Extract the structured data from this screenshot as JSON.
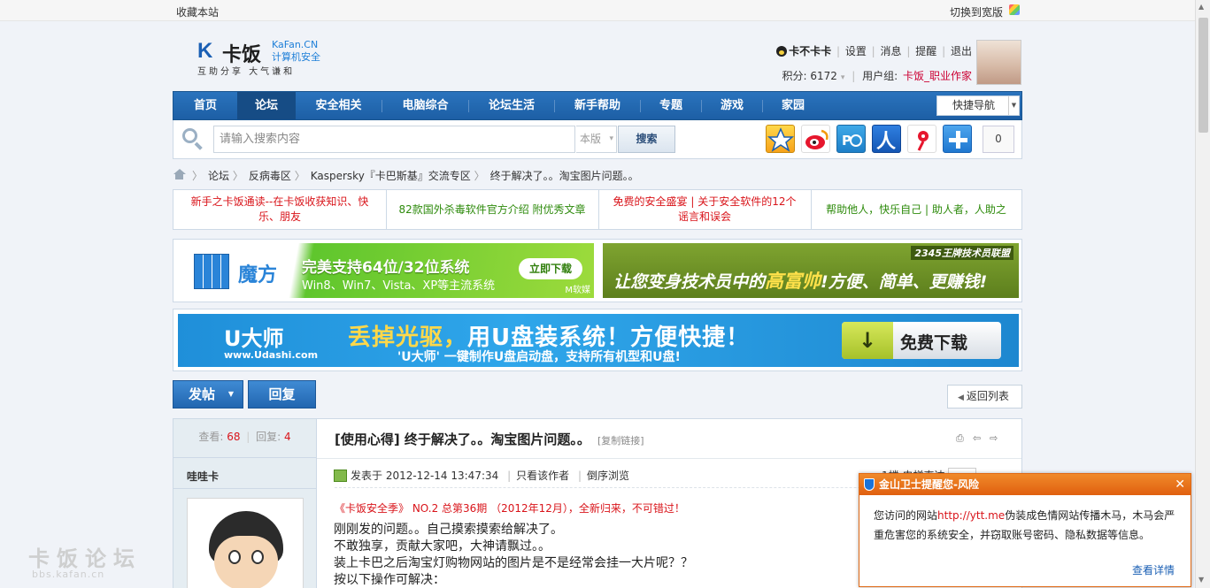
{
  "topbar": {
    "favorite": "收藏本站",
    "wide": "切换到宽版"
  },
  "logo": {
    "name": "卡饭",
    "en": "KaFan.CN",
    "sub": "计算机安全",
    "motto": "互助分享   大气谦和"
  },
  "user": {
    "name": "卡不卡卡",
    "links": [
      "设置",
      "消息",
      "提醒",
      "退出"
    ],
    "points_label": "积分: 6172",
    "group_label": "用户组: ",
    "group": "卡饭_职业作家"
  },
  "nav": {
    "items": [
      "首页",
      "论坛",
      "安全相关",
      "电脑综合",
      "论坛生活",
      "新手帮助",
      "专题",
      "游戏",
      "家园"
    ],
    "quick": "快捷导航"
  },
  "search": {
    "placeholder": "请输入搜索内容",
    "scope": "本版",
    "button": "搜索",
    "share_count": "0"
  },
  "breadcrumb": [
    "论坛",
    "反病毒区",
    "Kaspersky『卡巴斯基』交流专区",
    "终于解决了。。淘宝图片问题。。"
  ],
  "notices": [
    {
      "text": "新手之卡饭通读--在卡饭收获知识、快乐、朋友",
      "color": "#d9141a"
    },
    {
      "text": "82款国外杀毒软件官方介绍 附优秀文章",
      "color": "#2e8b0c"
    },
    {
      "text": "免费的安全盛宴 | 关于安全软件的12个谣言和误会",
      "color": "#d9141a"
    },
    {
      "text": "帮助他人，快乐自己 | 助人者，人助之",
      "color": "#2e8b0c"
    }
  ],
  "ads": {
    "mofang": {
      "brand": "魔方",
      "title": "完美支持64位/32位系统",
      "sub": "Win8、Win7、Vista、XP等主流系统",
      "button": "立即下载",
      "tag": "M软媒"
    },
    "alliance": {
      "tag": "2345王牌技术员联盟",
      "text_a": "让您变身技术员中的",
      "text_b": "高富帅",
      "text_c": "!方便、简单、更赚钱!"
    },
    "udashi": {
      "logo": "U大师",
      "url": "www.Udashi.com",
      "title_a": "丢掉光驱，",
      "title_b": "用U盘装系统！方便快捷！",
      "sub": "'U大师' 一键制作U盘启动盘，支持所有机型和U盘!",
      "button": "免费下载"
    }
  },
  "actions": {
    "post": "发帖",
    "reply": "回复",
    "back": "返回列表"
  },
  "post": {
    "views_label": "查看:",
    "views": "68",
    "replies_label": "回复:",
    "replies": "4",
    "title": "[使用心得] 终于解决了。。淘宝图片问题。。",
    "copy_link": "[复制链接]",
    "author": "哇哇卡",
    "posted": "发表于 2012-12-14 13:47:34",
    "only_author": "只看该作者",
    "order": "倒序浏览",
    "floor": "1楼 电梯直达",
    "promo": "《卡饭安全季》 NO.2 总第36期 （2012年12月），全新归来，不可错过！",
    "lines": [
      "刚刚发的问题。。自己摸索摸索给解决了。",
      "不敢独享，贡献大家吧，大神请飘过。。",
      "装上卡巴之后淘宝灯购物网站的图片是不是经常会挂一大片呢？？",
      "按以下操作可解决："
    ]
  },
  "popup": {
    "title": "金山卫士提醒您-风险",
    "msg_a": "您访问的网站",
    "msg_link": "http://ytt.me",
    "msg_b": "伪装成色情网站传播木马，木马会严重危害您的系统安全，并窃取账号密码、隐私数据等信息。",
    "more": "查看详情"
  },
  "watermark": {
    "cn": "卡饭论坛",
    "en": "bbs.kafan.cn"
  }
}
